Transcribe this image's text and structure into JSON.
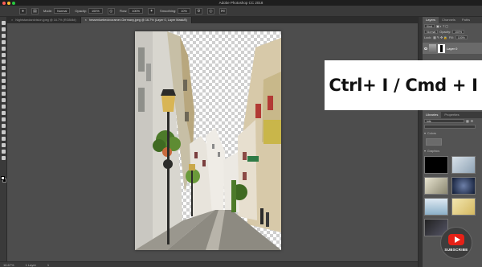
{
  "window": {
    "title": "Adobe Photoshop CC 2018",
    "traffic_lights": [
      "#ff5f57",
      "#febc2e",
      "#28c840"
    ]
  },
  "options_bar": {
    "mode_label": "Mode:",
    "mode_value": "Normal",
    "opacity_label": "Opacity:",
    "opacity_value": "100%",
    "flow_label": "Flow:",
    "flow_value": "100%",
    "smoothing_label": "Smoothing:",
    "smoothing_value": "10%"
  },
  "tabs": [
    {
      "label": "Nightstandardvision.jpeg @ 16.7% (RGB/8#)",
      "active": false
    },
    {
      "label": "hessenluebeckvoramer-Germany.jpeg @ 16.7% (Layer 0, Layer Mask/8)",
      "active": true
    }
  ],
  "status": {
    "zoom": "16.67%",
    "info": "1 Layer",
    "channel": "1"
  },
  "overlay": {
    "text": "Ctrl+ I / Cmd + I"
  },
  "layers_panel": {
    "tabs": [
      "Layers",
      "Channels",
      "Paths"
    ],
    "active_tab": "Layers",
    "kind_label": "Kind",
    "blend_mode": "Normal",
    "opacity_label": "Opacity:",
    "opacity_value": "100%",
    "lock_label": "Lock:",
    "fill_label": "Fill:",
    "fill_value": "100%",
    "layer_name": "Layer 0"
  },
  "libraries_panel": {
    "tabs": [
      "Libraries",
      "Properties"
    ],
    "active_tab": "Libraries",
    "library_value": "luts",
    "colors_label": "Colors",
    "graphics_label": "Graphics"
  },
  "subscribe": {
    "label": "SUBSCRIBE"
  },
  "colors": {
    "foreground": "#ffffff",
    "background": "#000000",
    "youtube_red": "#e62117"
  }
}
